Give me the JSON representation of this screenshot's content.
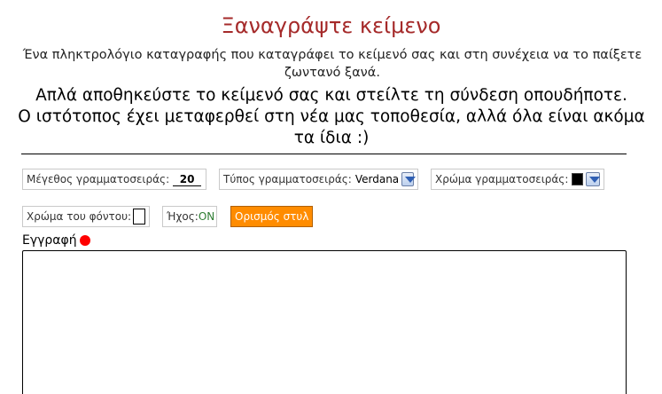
{
  "header": {
    "title": "Ξαναγράψτε κείμενο",
    "subtitle": "Ένα πληκτρολόγιο καταγραφής που καταγράφει το κείμενό σας και στη συνέχεια να το παίξετε ζωντανό ξανά.",
    "notice_line1": "Απλά αποθηκεύστε το κείμενό σας και στείλτε τη σύνδεση οπουδήποτε.",
    "notice_line2": "Ο ιστότοπος έχει μεταφερθεί στη νέα μας τοποθεσία, αλλά όλα είναι ακόμα τα ίδια :)"
  },
  "toolbar": {
    "font_size_label": "Μέγεθος γραμματοσειράς:",
    "font_size_value": "20",
    "font_type_label": "Τύπος γραμματοσειράς:",
    "font_type_value": "Verdana",
    "font_color_label": "Χρώμα γραμματοσειράς:",
    "font_color_value": "#000000",
    "bg_color_label": "Χρώμα του φόντου:",
    "bg_color_value": "#ffffff",
    "sound_label": "Ήχος:",
    "sound_value": "ON",
    "style_button_label": "Ορισμός στυλ"
  },
  "editor": {
    "record_label": "Εγγραφή",
    "record_indicator_color": "#ff0000",
    "text": ""
  },
  "colors": {
    "title": "#a52a2a",
    "style_button": "#ff8c00",
    "sound_on": "#2e7d32"
  }
}
